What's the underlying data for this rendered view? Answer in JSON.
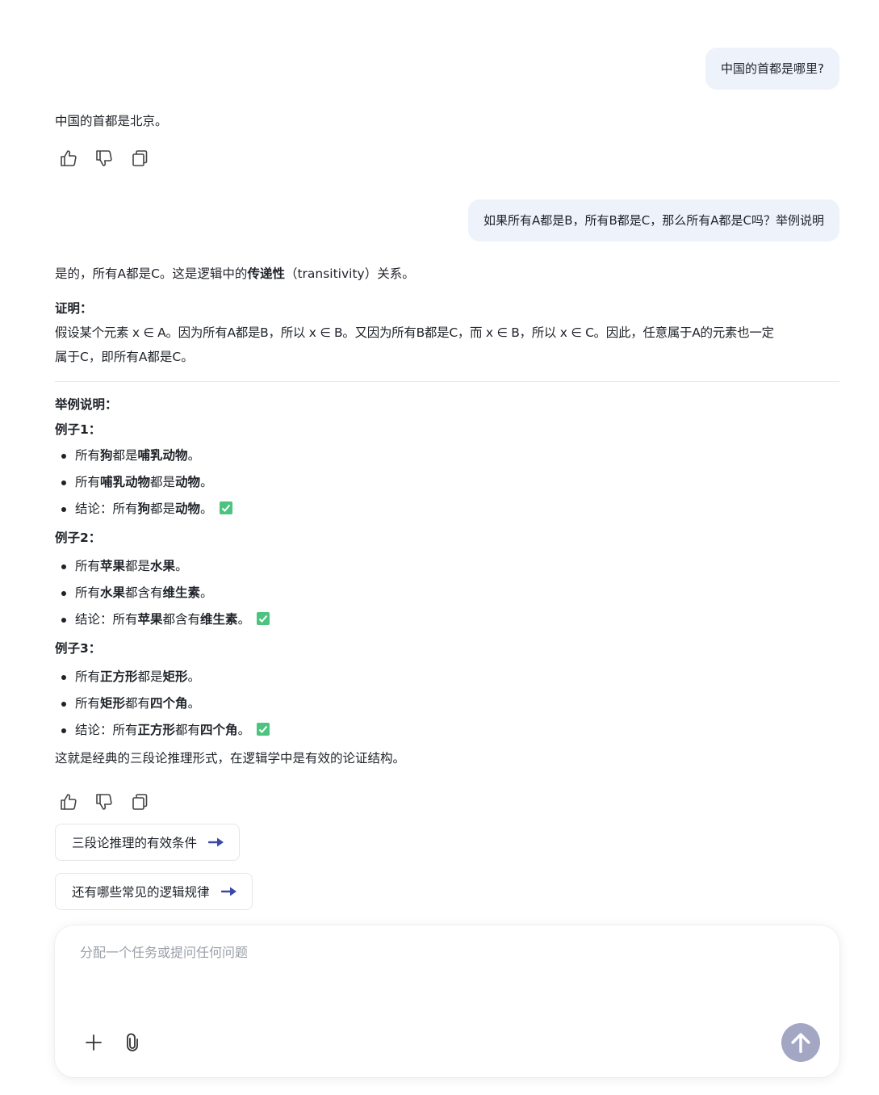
{
  "messages": {
    "q1": "中国的首都是哪里?",
    "a1": "中国的首都是北京。",
    "q2": "如果所有A都是B，所有B都是C，那么所有A都是C吗？举例说明",
    "a2": {
      "intro_pre": "是的，所有A都是C。这是逻辑中的",
      "intro_bold": "传递性",
      "intro_post": "（transitivity）关系。",
      "proof_heading": "证明：",
      "proof_line1": "假设某个元素 x ∈ A。因为所有A都是B，所以 x ∈ B。又因为所有B都是C，而 x ∈ B，所以 x ∈ C。因此，任意属于A的元素也一定",
      "proof_line2": "属于C，即所有A都是C。",
      "examples_heading": "举例说明：",
      "ex1": {
        "title": "例子1：",
        "l1": [
          "所有",
          "狗",
          "都是",
          "哺乳动物",
          "。"
        ],
        "l2": [
          "所有",
          "哺乳动物",
          "都是",
          "动物",
          "。"
        ],
        "l3": [
          "结论：所有",
          "狗",
          "都是",
          "动物",
          "。"
        ]
      },
      "ex2": {
        "title": "例子2：",
        "l1": [
          "所有",
          "苹果",
          "都是",
          "水果",
          "。"
        ],
        "l2": [
          "所有",
          "水果",
          "都含有",
          "维生素",
          "。"
        ],
        "l3": [
          "结论：所有",
          "苹果",
          "都含有",
          "维生素",
          "。"
        ]
      },
      "ex3": {
        "title": "例子3：",
        "l1": [
          "所有",
          "正方形",
          "都是",
          "矩形",
          "。"
        ],
        "l2": [
          "所有",
          "矩形",
          "都有",
          "四个角",
          "。"
        ],
        "l3": [
          "结论：所有",
          "正方形",
          "都有",
          "四个角",
          "。"
        ]
      },
      "conclusion": "这就是经典的三段论推理形式，在逻辑学中是有效的论证结构。"
    }
  },
  "icons": {
    "like": "thumbs-up-icon",
    "dislike": "thumbs-down-icon",
    "copy": "copy-icon",
    "check": "check-mark-icon",
    "arrow": "arrow-right-icon",
    "plus": "plus-icon",
    "attach": "paperclip-icon",
    "send": "arrow-up-icon"
  },
  "suggestions": [
    "三段论推理的有效条件",
    "还有哪些常见的逻辑规律"
  ],
  "composer": {
    "placeholder": "分配一个任务或提问任何问题"
  },
  "colors": {
    "accent": "#3a48a8",
    "check": "#4cc47f",
    "send_bg": "#a3a7c4",
    "bubble_bg": "#eef2fb"
  }
}
